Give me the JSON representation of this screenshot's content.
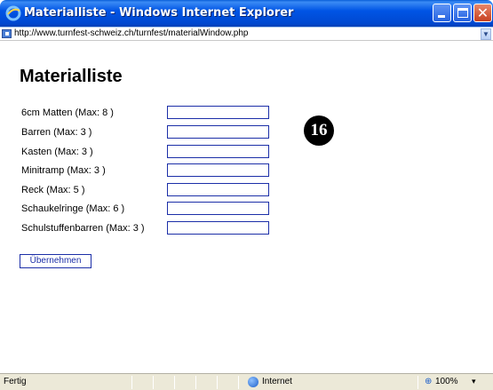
{
  "window": {
    "title": "Materialliste - Windows Internet Explorer",
    "icon": "ie-icon",
    "address": "http://www.turnfest-schweiz.ch/turnfest/materialWindow.php",
    "close_glyph": "✕"
  },
  "page": {
    "title": "Materialliste",
    "rows": [
      {
        "label": "6cm Matten (Max: 8 )",
        "value": ""
      },
      {
        "label": "Barren (Max: 3 )",
        "value": ""
      },
      {
        "label": "Kasten (Max: 3 )",
        "value": ""
      },
      {
        "label": "Minitramp (Max: 3 )",
        "value": ""
      },
      {
        "label": "Reck (Max: 5 )",
        "value": ""
      },
      {
        "label": "Schaukelringe (Max: 6 )",
        "value": ""
      },
      {
        "label": "Schulstuffenbarren (Max: 3 )",
        "value": ""
      }
    ],
    "submit_label": "Übernehmen",
    "step_badge": "16"
  },
  "statusbar": {
    "status": "Fertig",
    "zone": "Internet",
    "zoom": "100%",
    "zoom_arrow": "▾"
  },
  "colors": {
    "titlebar": "#0055e5",
    "input_border": "#1c2fa8",
    "statusbar_bg": "#ece9d8"
  }
}
